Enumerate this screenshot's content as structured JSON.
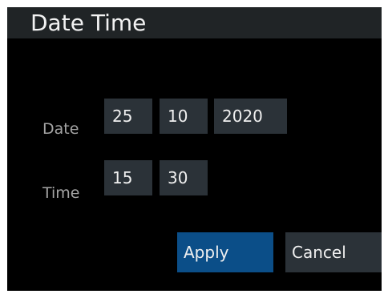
{
  "dialog": {
    "title": "Date Time"
  },
  "date": {
    "label": "Date",
    "day": "25",
    "month": "10",
    "year": "2020"
  },
  "time": {
    "label": "Time",
    "hour": "15",
    "minute": "30"
  },
  "buttons": {
    "apply_label": "Apply",
    "cancel_label": "Cancel"
  },
  "colors": {
    "background": "#000000",
    "title_bar": "#202426",
    "field": "#2b3238",
    "accent": "#0b4e88",
    "label_text": "#a4a4a4",
    "text": "#f0f0f0"
  }
}
